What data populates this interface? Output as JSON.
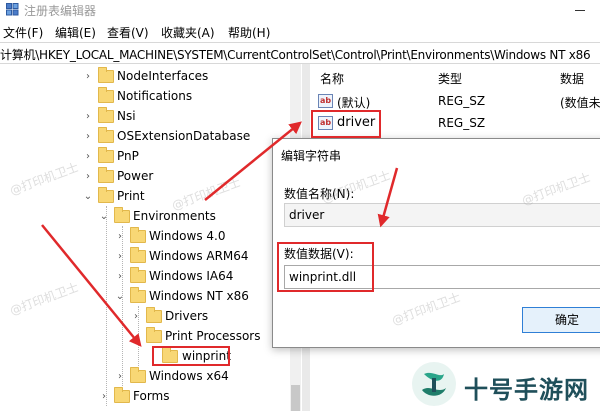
{
  "window": {
    "title": "注册表编辑器"
  },
  "menu": [
    "文件(F)",
    "编辑(E)",
    "查看(V)",
    "收藏夹(A)",
    "帮助(H)"
  ],
  "address": "计算机\\HKEY_LOCAL_MACHINE\\SYSTEM\\CurrentControlSet\\Control\\Print\\Environments\\Windows NT x86",
  "tree": [
    {
      "label": "NodeInterfaces"
    },
    {
      "label": "Notifications"
    },
    {
      "label": "Nsi"
    },
    {
      "label": "OSExtensionDatabase"
    },
    {
      "label": "PnP"
    },
    {
      "label": "Power"
    },
    {
      "label": "Print"
    },
    {
      "label": "Environments"
    },
    {
      "label": "Windows 4.0"
    },
    {
      "label": "Windows ARM64"
    },
    {
      "label": "Windows IA64"
    },
    {
      "label": "Windows NT x86"
    },
    {
      "label": "Drivers"
    },
    {
      "label": "Print Processors"
    },
    {
      "label": "winprint"
    },
    {
      "label": "Windows x64"
    },
    {
      "label": "Forms"
    }
  ],
  "list": {
    "headers": {
      "name": "名称",
      "type": "类型",
      "data": "数据"
    },
    "rows": [
      {
        "icon": "ab",
        "name": "(默认)",
        "type": "REG_SZ",
        "data": "(数值未"
      },
      {
        "icon": "ab",
        "name": "driver",
        "type": "REG_SZ",
        "data": ""
      }
    ]
  },
  "dialog": {
    "title": "编辑字符串",
    "name_label": "数值名称(N):",
    "name_value": "driver",
    "data_label": "数值数据(V):",
    "data_value": "winprint.dll",
    "ok_label": "确定"
  },
  "watermark": "@打印机卫士",
  "brand": {
    "text": "十号手游网"
  },
  "colors": {
    "highlight": "#e0292b",
    "folder": "#f8d775",
    "accent": "#2f7fd6"
  }
}
